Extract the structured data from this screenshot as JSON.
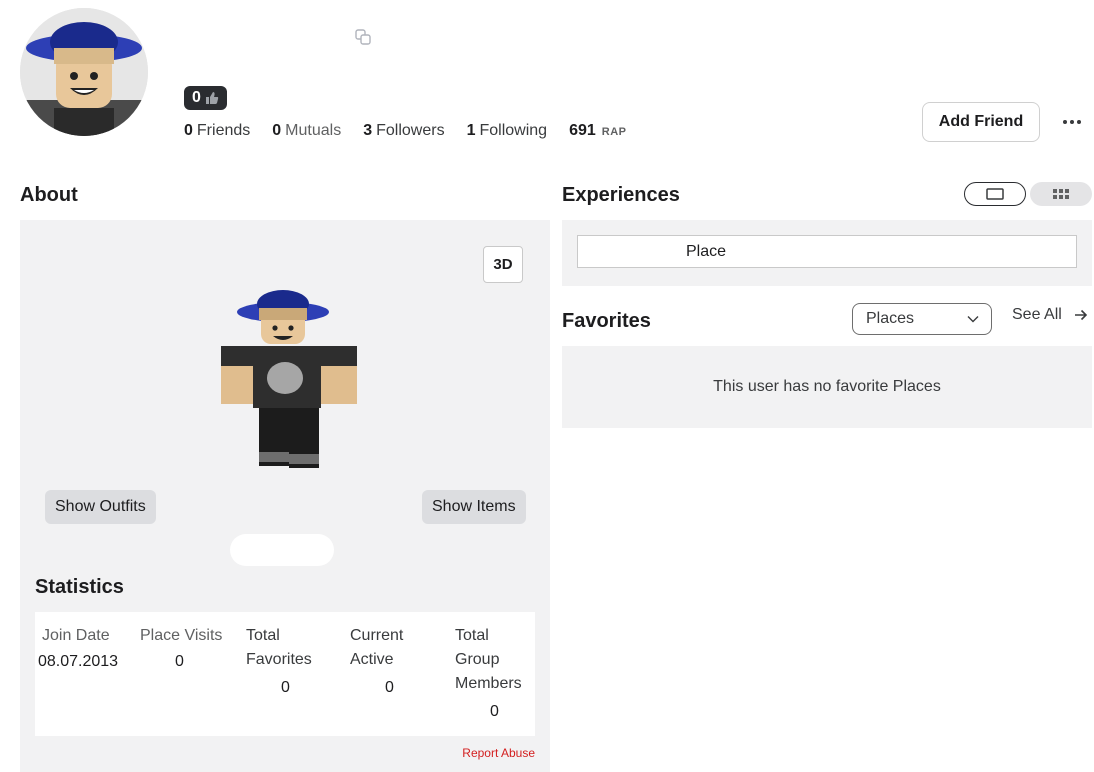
{
  "header": {
    "rating": "0",
    "stats": [
      {
        "value": "0",
        "label": "Friends"
      },
      {
        "value": "0",
        "label": "Mutuals"
      },
      {
        "value": "3",
        "label": "Followers"
      },
      {
        "value": "1",
        "label": "Following"
      }
    ],
    "rap_value": "691",
    "rap_label": "RAP",
    "add_friend_label": "Add Friend",
    "more_icon": "more-horizontal-icon",
    "copy_icon": "copy-icon"
  },
  "about": {
    "title": "About",
    "btn_3d_label": "3D",
    "show_outfits_label": "Show Outfits",
    "show_items_label": "Show Items",
    "statistics": {
      "title": "Statistics",
      "join_date_label": "Join Date",
      "join_date_value": "08.07.2013",
      "place_visits_label": "Place Visits",
      "place_visits_value": "0",
      "total_favorites_label": "Total Favorites",
      "total_favorites_value": "0",
      "current_active_label": "Current Active",
      "current_active_value": "0",
      "group_members_label": "Total Group Members",
      "group_members_value": "0"
    },
    "report_abuse_label": "Report Abuse"
  },
  "experiences": {
    "title": "Experiences",
    "list_view_icon": "list-view-icon",
    "grid_view_icon": "grid-view-icon",
    "items": [
      {
        "label": "Place"
      }
    ]
  },
  "favorites": {
    "title": "Favorites",
    "dropdown_selected": "Places",
    "see_all_label": "See All",
    "empty_message": "This user has no favorite Places"
  },
  "colors": {
    "panel_bg": "#f2f2f3",
    "report_abuse": "#d31f1f",
    "badge_bg": "#2a2c30"
  }
}
